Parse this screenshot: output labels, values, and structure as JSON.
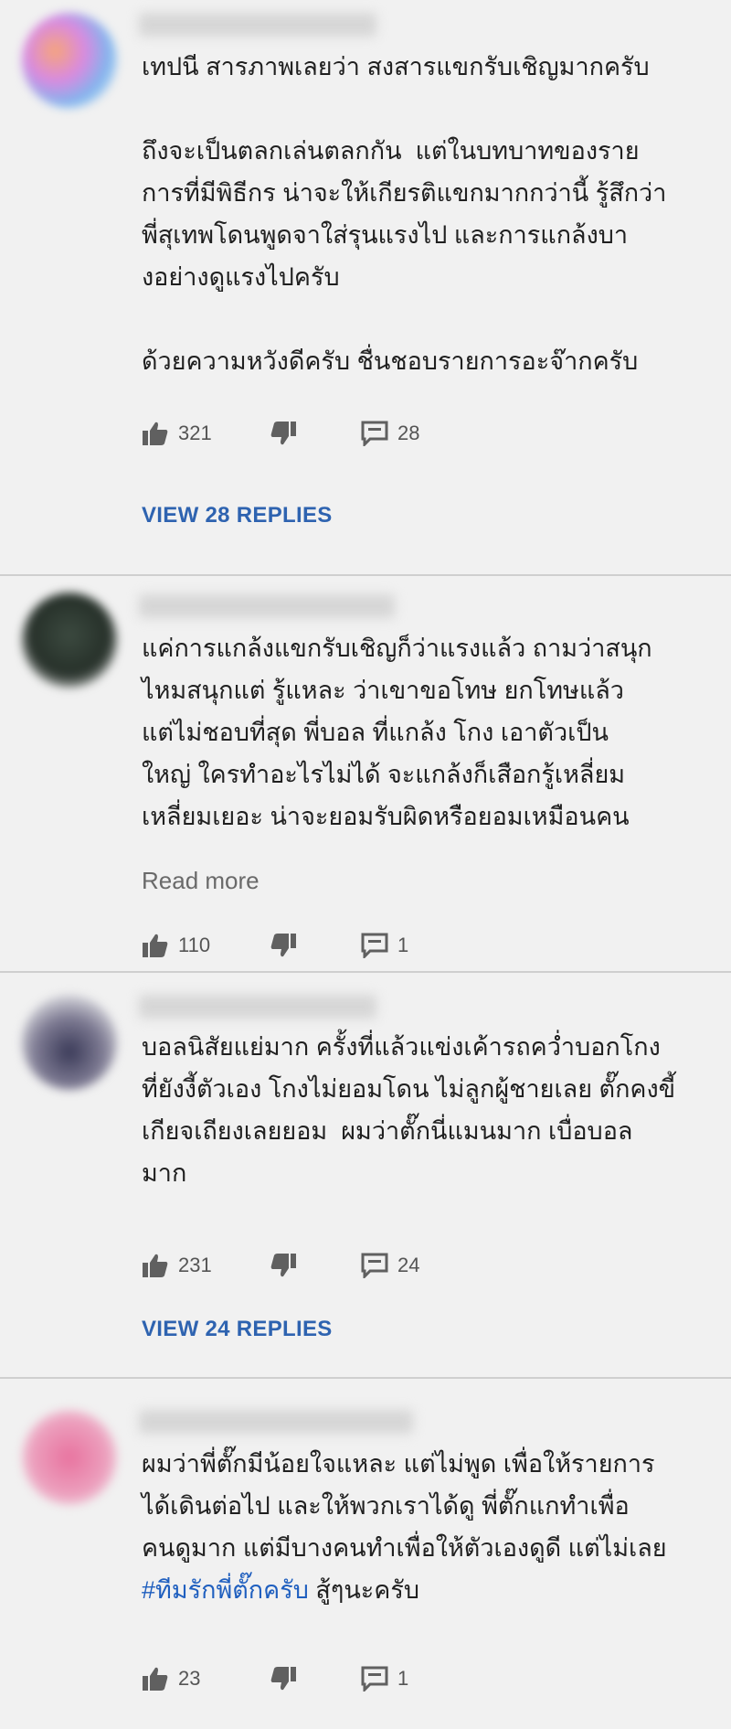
{
  "comments": [
    {
      "avatar_color": "#b56fd0",
      "lines": "เทปนี สารภาพเลยว่า สงสารแขกรับเชิญมากครับ\n\nถึงจะเป็นตลกเล่นตลกกัน  แต่ในบทบาทของราย\nการที่มีพิธีกร น่าจะให้เกียรติแขกมากกว่านี้ รู้สึกว่า\nพี่สุเทพโดนพูดจาใส่รุนแรงไป และการแกล้งบา\nงอย่างดูแรงไปครับ\n\nด้วยความหวังดีครับ ชื่นชอบรายการอะจ๊ากครับ",
      "likes": "321",
      "replies_count": "28",
      "view_replies": "VIEW 28 REPLIES"
    },
    {
      "avatar_color": "#2f3a33",
      "lines": "แค่การแกล้งแขกรับเชิญก็ว่าแรงแล้ว ถามว่าสนุก\nไหมสนุกแต่ รู้แหละ ว่าเขาขอโทษ ยกโทษแล้ว\nแต่ไม่ชอบที่สุด พี่บอล ที่แกล้ง โกง เอาตัวเป็น\nใหญ่ ใครทำอะไรไม่ได้ จะแกล้งก็เสือกรู้เหลี่ยม\nเหลี่ยมเยอะ น่าจะยอมรับผิดหรือยอมเหมือนคน",
      "read_more": "Read more",
      "likes": "110",
      "replies_count": "1"
    },
    {
      "avatar_color": "#4a4766",
      "lines": "บอลนิสัยแย่มาก ครั้งที่แล้วแข่งเค้ารถคว่ำบอกโกง\nที่ยังงี้ตัวเอง โกงไม่ยอมโดน ไม่ลูกผู้ชายเลย ตั๊กคงขี้\nเกียจเถียงเลยยอม  ผมว่าตั๊กนี่แมนมาก เบื่อบอล\nมาก",
      "likes": "231",
      "replies_count": "24",
      "view_replies": "VIEW 24 REPLIES"
    },
    {
      "avatar_color": "#e27fa6",
      "lines": "ผมว่าพี่ตั๊กมีน้อยใจแหละ แต่ไม่พูด เพื่อให้รายการ\nได้เดินต่อไป และให้พวกเราได้ดู พี่ตั๊กแกทำเพื่อ\nคนดูมาก แต่มีบางคนทำเพื่อให้ตัวเองดูดี แต่ไม่เลย",
      "hashtag": "#ทีมรักพี่ตั๊กครับ",
      "after_hashtag": " สู้ๆนะครับ",
      "likes": "23",
      "replies_count": "1"
    }
  ]
}
